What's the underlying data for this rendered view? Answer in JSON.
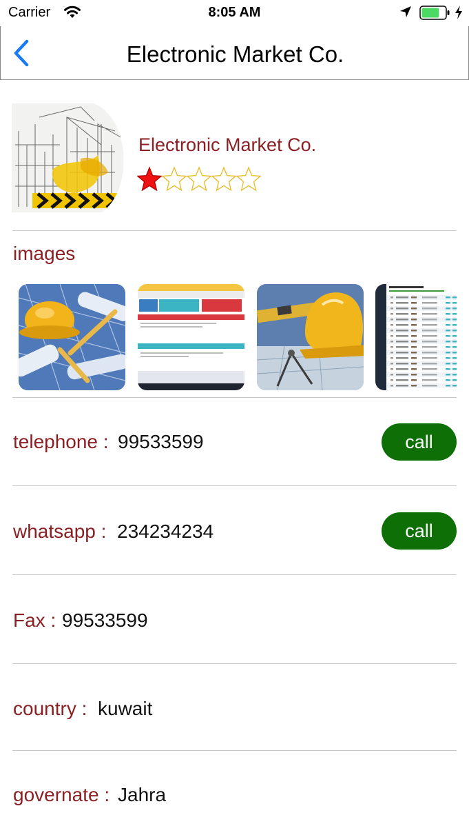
{
  "status": {
    "carrier": "Carrier",
    "time": "8:05 AM",
    "battery_level": 0.75,
    "icons": [
      "wifi-icon",
      "location-arrow-icon",
      "battery-icon",
      "charging-bolt-icon"
    ]
  },
  "nav": {
    "title": "Electronic Market Co.",
    "back_icon": "chevron-left-icon"
  },
  "company": {
    "name": "Electronic Market Co.",
    "rating": 1,
    "rating_max": 5
  },
  "images_section": {
    "title": "images",
    "thumbnails": [
      "hard-hat-blueprints",
      "website-screenshot",
      "construction-tools",
      "admin-table-screenshot"
    ]
  },
  "contacts": {
    "telephone": {
      "label": "telephone :",
      "value": "99533599",
      "button": "call"
    },
    "whatsapp": {
      "label": "whatsapp :",
      "value": "234234234",
      "button": "call"
    },
    "fax": {
      "label": "Fax :",
      "value": "99533599"
    },
    "country": {
      "label": "country :",
      "value": "kuwait"
    },
    "governate": {
      "label": "governate :",
      "value": "Jahra"
    }
  },
  "colors": {
    "accent_red": "#8b2024",
    "call_green": "#0d6f06",
    "ios_blue": "#1a7cf3",
    "star_filled": "#ee1111",
    "star_outline": "#e8b923"
  }
}
